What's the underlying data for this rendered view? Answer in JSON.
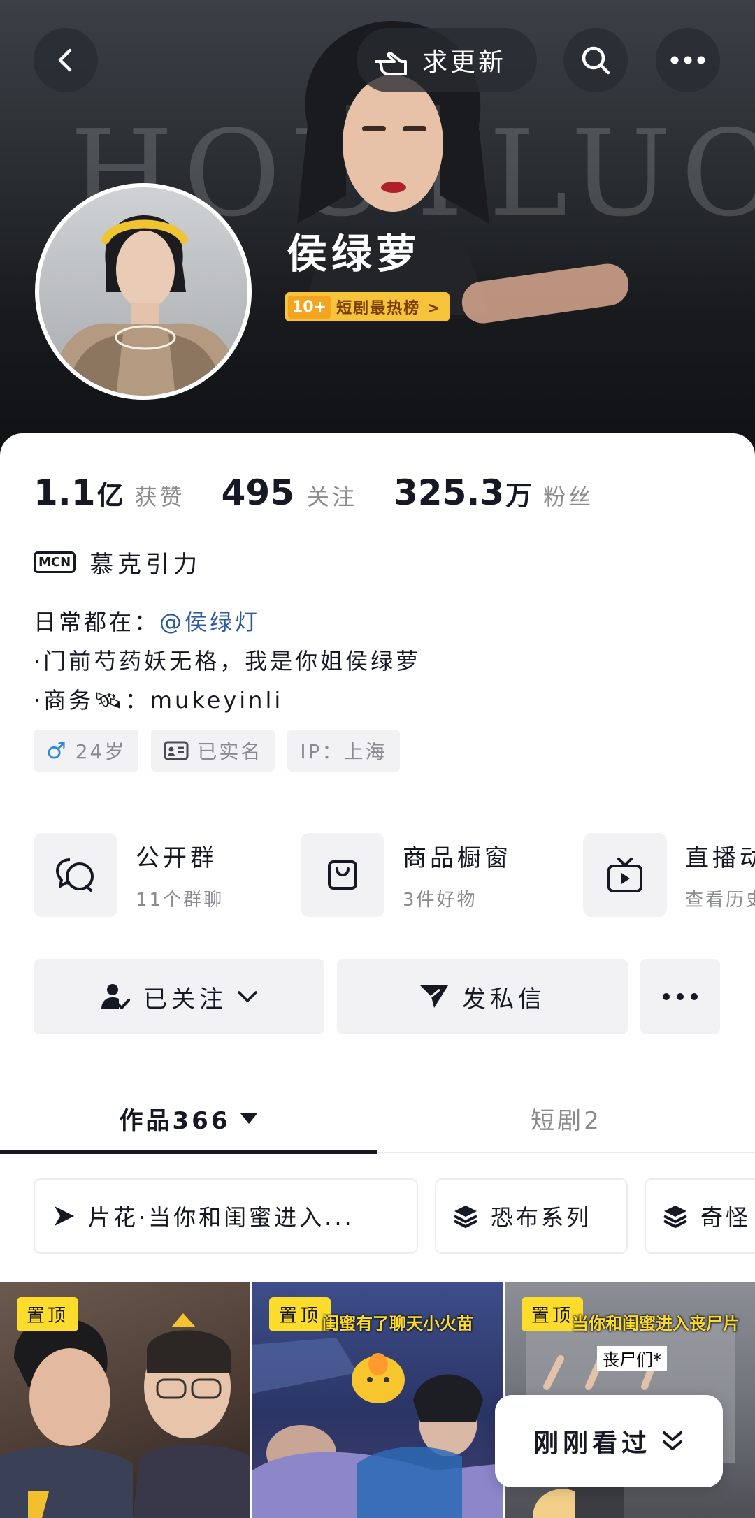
{
  "header": {
    "banner_word": "HOUYLUO",
    "request_update_label": "求更新",
    "profile_name": "侯绿萝",
    "rank_badge": {
      "number": "10+",
      "text": "短剧最热榜 >"
    }
  },
  "stats": [
    {
      "value": "1.1",
      "unit": "亿",
      "label": "获赞"
    },
    {
      "value": "495",
      "unit": "",
      "label": "关注"
    },
    {
      "value": "325.3",
      "unit": "万",
      "label": "粉丝"
    }
  ],
  "mcn": {
    "badge": "MCN",
    "name": "慕克引力"
  },
  "bio": {
    "line1_prefix": "日常都在：",
    "line1_mention": "@侯绿灯",
    "line2": "·门前芍药妖无格，我是你姐侯绿萝",
    "line3_prefix": "·商务",
    "line3_suffix": "：mukeyinli"
  },
  "tags": [
    {
      "icon": "male-icon",
      "text": "24岁"
    },
    {
      "icon": "id-card-icon",
      "text": "已实名"
    },
    {
      "icon": "",
      "text": "IP：上海"
    }
  ],
  "entries": [
    {
      "icon": "group-chat-icon",
      "title": "公开群",
      "sub": "11个群聊"
    },
    {
      "icon": "shopping-bag-icon",
      "title": "商品橱窗",
      "sub": "3件好物"
    },
    {
      "icon": "live-tv-icon",
      "title": "直播动态",
      "sub": "查看历史"
    }
  ],
  "actions": {
    "follow": "已关注",
    "message": "发私信"
  },
  "tabs": {
    "works": "作品366",
    "dramas": "短剧2"
  },
  "collections": [
    {
      "icon": "play-icon",
      "text": "片花·当你和闺蜜进入..."
    },
    {
      "icon": "stack-icon",
      "text": "恐布系列"
    },
    {
      "icon": "stack-icon",
      "text": "奇怪"
    }
  ],
  "thumbs": [
    {
      "pin": "置顶",
      "caption": "",
      "caption2": ""
    },
    {
      "pin": "置顶",
      "caption": "闺蜜有了聊天小火苗",
      "caption2": ""
    },
    {
      "pin": "置顶",
      "caption": "当你和闺蜜进入丧尸片",
      "caption2": "丧尸们*"
    }
  ],
  "recent_label": "刚刚看过",
  "colors": {
    "accent_yellow": "#fddc2b",
    "mention_blue": "#2d5a9a",
    "muted": "#8a8b91"
  }
}
